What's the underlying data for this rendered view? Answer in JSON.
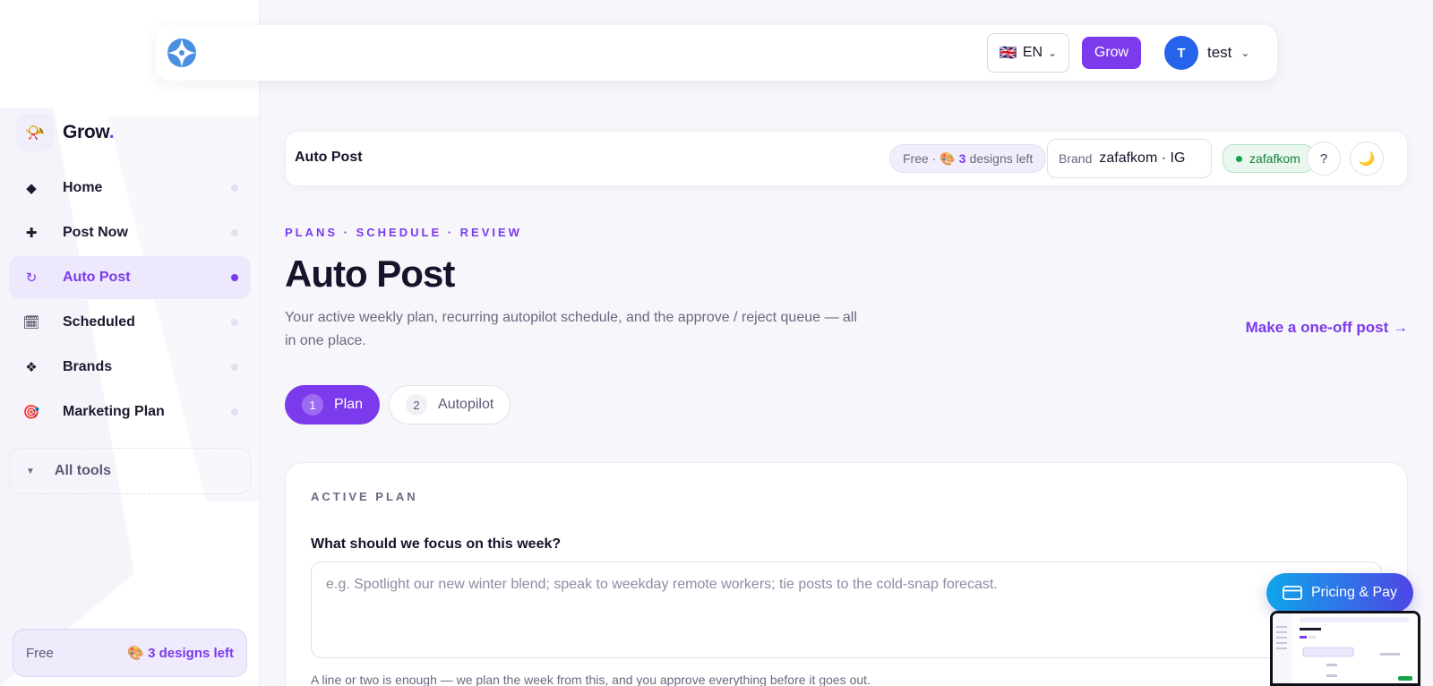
{
  "topbar": {
    "language": {
      "flag": "🇬🇧",
      "value": "EN"
    },
    "grow_label": "Grow",
    "user": {
      "initial": "T",
      "name": "test"
    }
  },
  "sidebar": {
    "brand": {
      "name": "Grow",
      "dot": ".",
      "logo_glyph": "📯"
    },
    "items": [
      {
        "label": "Home",
        "icon": "◆",
        "icon_name": "diamond-icon",
        "active": false
      },
      {
        "label": "Post Now",
        "icon": "✚",
        "icon_name": "plus-icon",
        "active": false
      },
      {
        "label": "Auto Post",
        "icon": "↻",
        "icon_name": "refresh-icon",
        "active": true
      },
      {
        "label": "Scheduled",
        "icon": "🗓",
        "icon_name": "calendar-icon",
        "active": false
      },
      {
        "label": "Brands",
        "icon": "❖",
        "icon_name": "brands-icon",
        "active": false
      },
      {
        "label": "Marketing Plan",
        "icon": "🎯",
        "icon_name": "target-icon",
        "active": false
      }
    ],
    "all_tools_label": "All tools",
    "free_card": {
      "label": "Free",
      "value": "🎨 3 designs left"
    }
  },
  "pagebar": {
    "title": "Auto Post",
    "free_pill": {
      "prefix": "Free · 🎨",
      "count": "3",
      "suffix": "designs left"
    },
    "brand_select": {
      "label": "Brand",
      "value": "zafafkom · IG"
    },
    "status": "zafafkom",
    "help_glyph": "?",
    "theme_glyph": "🌙"
  },
  "main": {
    "eyebrow": "PLANS · SCHEDULE · REVIEW",
    "title": "Auto Post",
    "subtitle": "Your active weekly plan, recurring autopilot schedule, and the approve / reject queue — all in one place.",
    "oneoff_link": "Make a one-off post →",
    "tabs": [
      {
        "num": "1",
        "label": "Plan",
        "active": true
      },
      {
        "num": "2",
        "label": "Autopilot",
        "active": false
      }
    ],
    "plan": {
      "eyebrow": "ACTIVE PLAN",
      "question": "What should we focus on this week?",
      "placeholder": "e.g. Spotlight our new winter blend; speak to weekday remote workers; tie posts to the cold-snap forecast.",
      "helper": "A line or two is enough — we plan the week from this, and you approve everything before it goes out."
    }
  },
  "floating": {
    "pricing_label": "Pricing & Pay"
  },
  "colors": {
    "accent": "#7c3aed",
    "avatar": "#2563eb",
    "status_green": "#16a34a"
  }
}
